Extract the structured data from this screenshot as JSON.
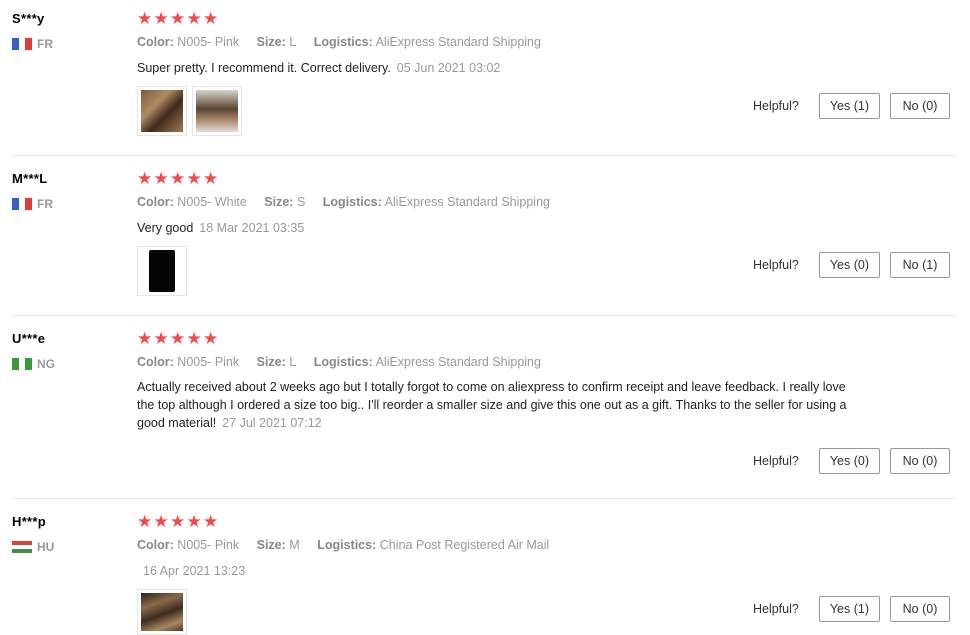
{
  "labels": {
    "color": "Color:",
    "size": "Size:",
    "logistics": "Logistics:",
    "helpful": "Helpful?"
  },
  "star_color": "#f04a4a",
  "reviews": [
    {
      "user": "S***y",
      "country": "FR",
      "rating": 5,
      "color": "N005- Pink",
      "size": "L",
      "logistics": "AliExpress Standard Shipping",
      "text": "Super pretty. I recommend it. Correct delivery.",
      "date": "05 Jun 2021 03:02",
      "photos": 2,
      "yes": "Yes (1)",
      "no": "No (0)"
    },
    {
      "user": "M***L",
      "country": "FR",
      "rating": 5,
      "color": "N005- White",
      "size": "S",
      "logistics": "AliExpress Standard Shipping",
      "text": "Very good",
      "date": "18 Mar 2021 03:35",
      "photos": 1,
      "yes": "Yes (0)",
      "no": "No (1)"
    },
    {
      "user": "U***e",
      "country": "NG",
      "rating": 5,
      "color": "N005- Pink",
      "size": "L",
      "logistics": "AliExpress Standard Shipping",
      "text": "Actually received about 2 weeks ago but I totally forgot to come on aliexpress to confirm receipt and leave feedback. I really love the top although I ordered a size too big.. I'll reorder a smaller size and give this one out as a gift. Thanks to the seller for using a good material!",
      "date": "27 Jul 2021 07:12",
      "photos": 0,
      "yes": "Yes (0)",
      "no": "No (0)"
    },
    {
      "user": "H***p",
      "country": "HU",
      "rating": 5,
      "color": "N005- Pink",
      "size": "M",
      "logistics": "China Post Registered Air Mail",
      "text": "",
      "date": "16 Apr 2021 13:23",
      "photos": 1,
      "yes": "Yes (1)",
      "no": "No (0)"
    }
  ]
}
